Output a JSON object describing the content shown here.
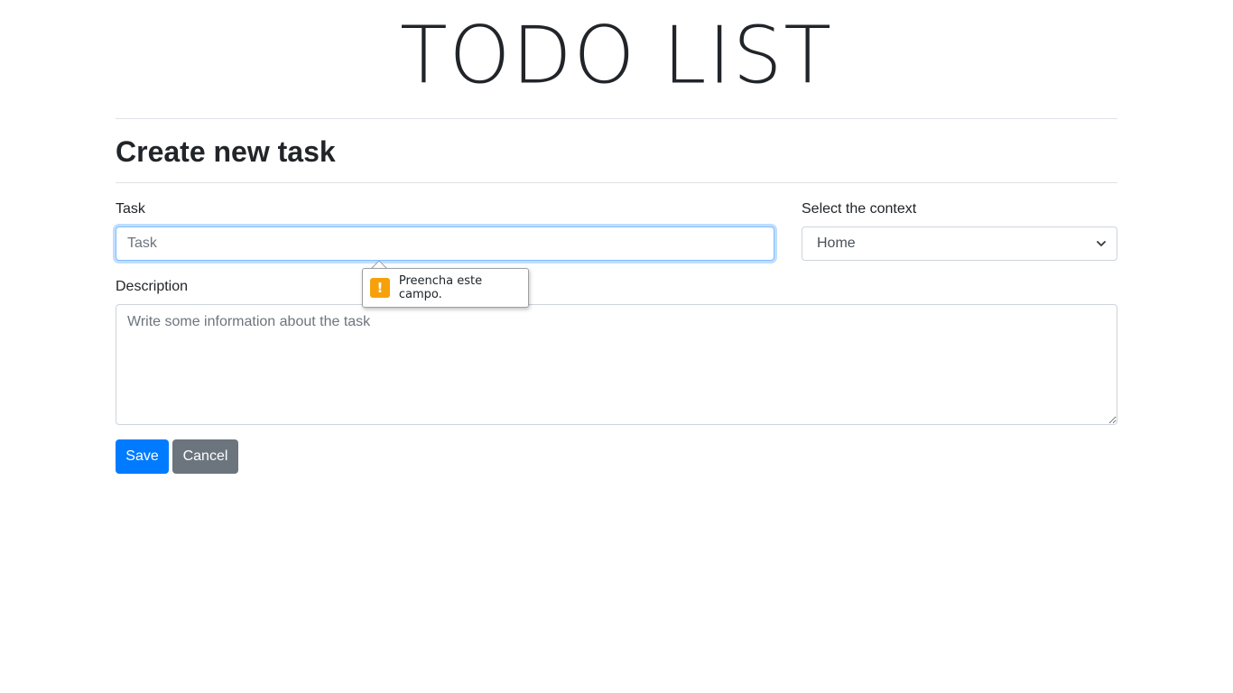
{
  "app": {
    "title": "TODO LIST"
  },
  "form": {
    "heading": "Create new task",
    "task": {
      "label": "Task",
      "placeholder": "Task",
      "value": ""
    },
    "context": {
      "label": "Select the context",
      "selected": "Home"
    },
    "description": {
      "label": "Description",
      "placeholder": "Write some information about the task",
      "value": ""
    },
    "buttons": {
      "save_label": "Save",
      "cancel_label": "Cancel"
    },
    "validation_tooltip": {
      "message": "Preencha este campo.",
      "icon": "warning-icon"
    }
  },
  "colors": {
    "primary": "#007bff",
    "secondary": "#6c757d",
    "focus_border": "#80bdff",
    "warning": "#f7a10a",
    "text": "#212529"
  }
}
